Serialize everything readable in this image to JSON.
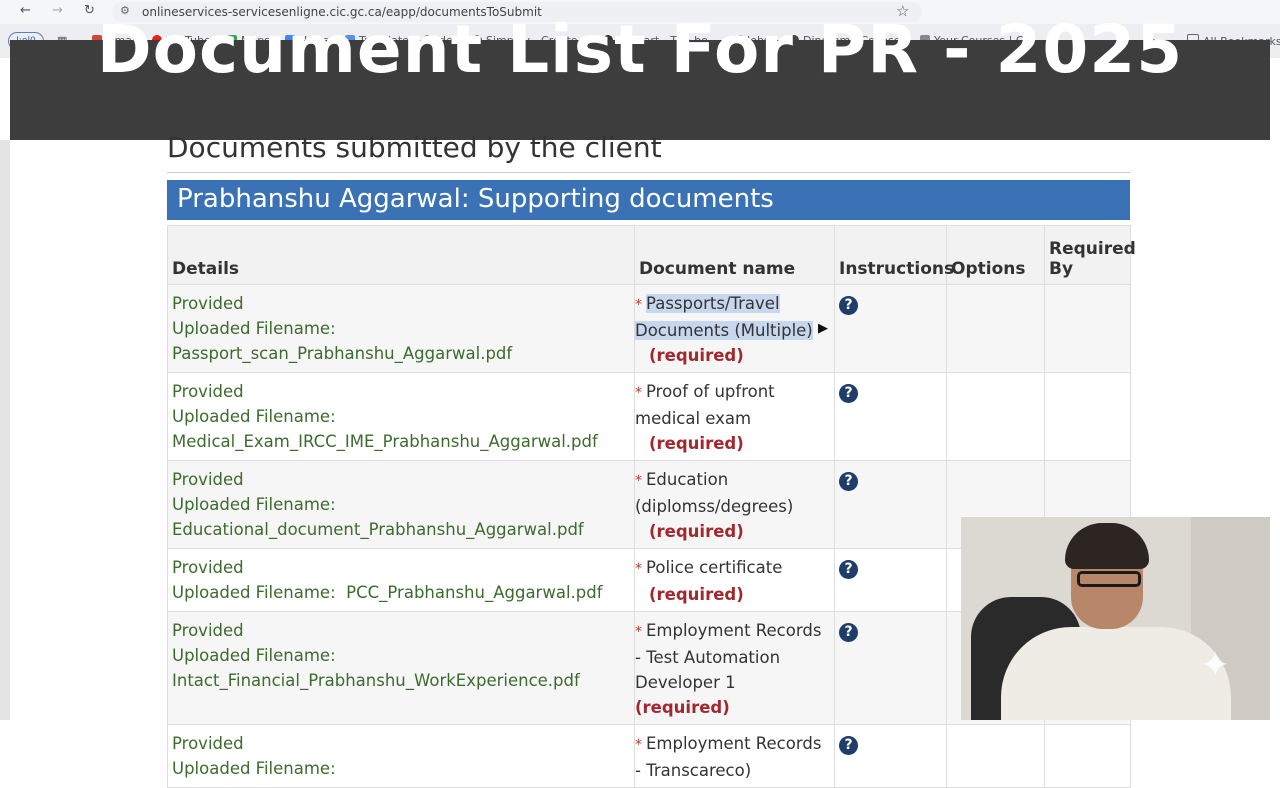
{
  "browser": {
    "url": "onlineservices-servicesenligne.cic.gc.ca/eapp/documentsToSubmit",
    "bookmarks": [
      "Gmail",
      "YouTube",
      "Maps",
      "News",
      "Translate",
      "des",
      "Simplify - Create y...",
      "Dossart - Tha ho...",
      "Jobs",
      "Dinothme Colloce...",
      "Your Courses | Cra..."
    ],
    "all_bookmarks": "All Bookmarks",
    "profile_label": "I:ol0",
    "more": "»"
  },
  "banner": {
    "title": "Document List For PR - 2025"
  },
  "page": {
    "section_heading": "Documents submitted by the client",
    "panel_title": "Prabhanshu Aggarwal: Supporting documents"
  },
  "table": {
    "headers": [
      "Details",
      "Document name",
      "Instructions",
      "Options",
      "Required By"
    ],
    "rows": [
      {
        "status": "Provided",
        "uploaded_label": "Uploaded Filename:",
        "filename": "Passport_scan_Prabhanshu_Aggarwal.pdf",
        "doc_name": "Passports/Travel Documents (Multiple)",
        "required": "(required)"
      },
      {
        "status": "Provided",
        "uploaded_label": "Uploaded Filename:",
        "filename": "Medical_Exam_IRCC_IME_Prabhanshu_Aggarwal.pdf",
        "doc_name": "Proof of upfront medical exam",
        "required": "(required)"
      },
      {
        "status": "Provided",
        "uploaded_label": "Uploaded Filename:",
        "filename": "Educational_document_Prabhanshu_Aggarwal.pdf",
        "doc_name": "Education (diplomss/degrees)",
        "required": "(required)"
      },
      {
        "status": "Provided",
        "uploaded_label": "Uploaded Filename:",
        "filename": "PCC_Prabhanshu_Aggarwal.pdf",
        "doc_name": "Police certificate",
        "required": "(required)"
      },
      {
        "status": "Provided",
        "uploaded_label": "Uploaded Filename:",
        "filename": "Intact_Financial_Prabhanshu_WorkExperience.pdf",
        "doc_name": "Employment Records - Test Automation Developer 1",
        "required": "(required)"
      },
      {
        "status": "Provided",
        "uploaded_label": "Uploaded Filename:",
        "filename": "",
        "doc_name": "Employment Records - Transcareco)",
        "required": ""
      }
    ],
    "help_glyph": "?"
  },
  "colors": {
    "banner_bg": "#3d3d3d",
    "panel_blue": "#3a72b5",
    "provided_green": "#3c6b2e",
    "required_red": "#a3282e",
    "help_icon": "#1e3d6b"
  }
}
